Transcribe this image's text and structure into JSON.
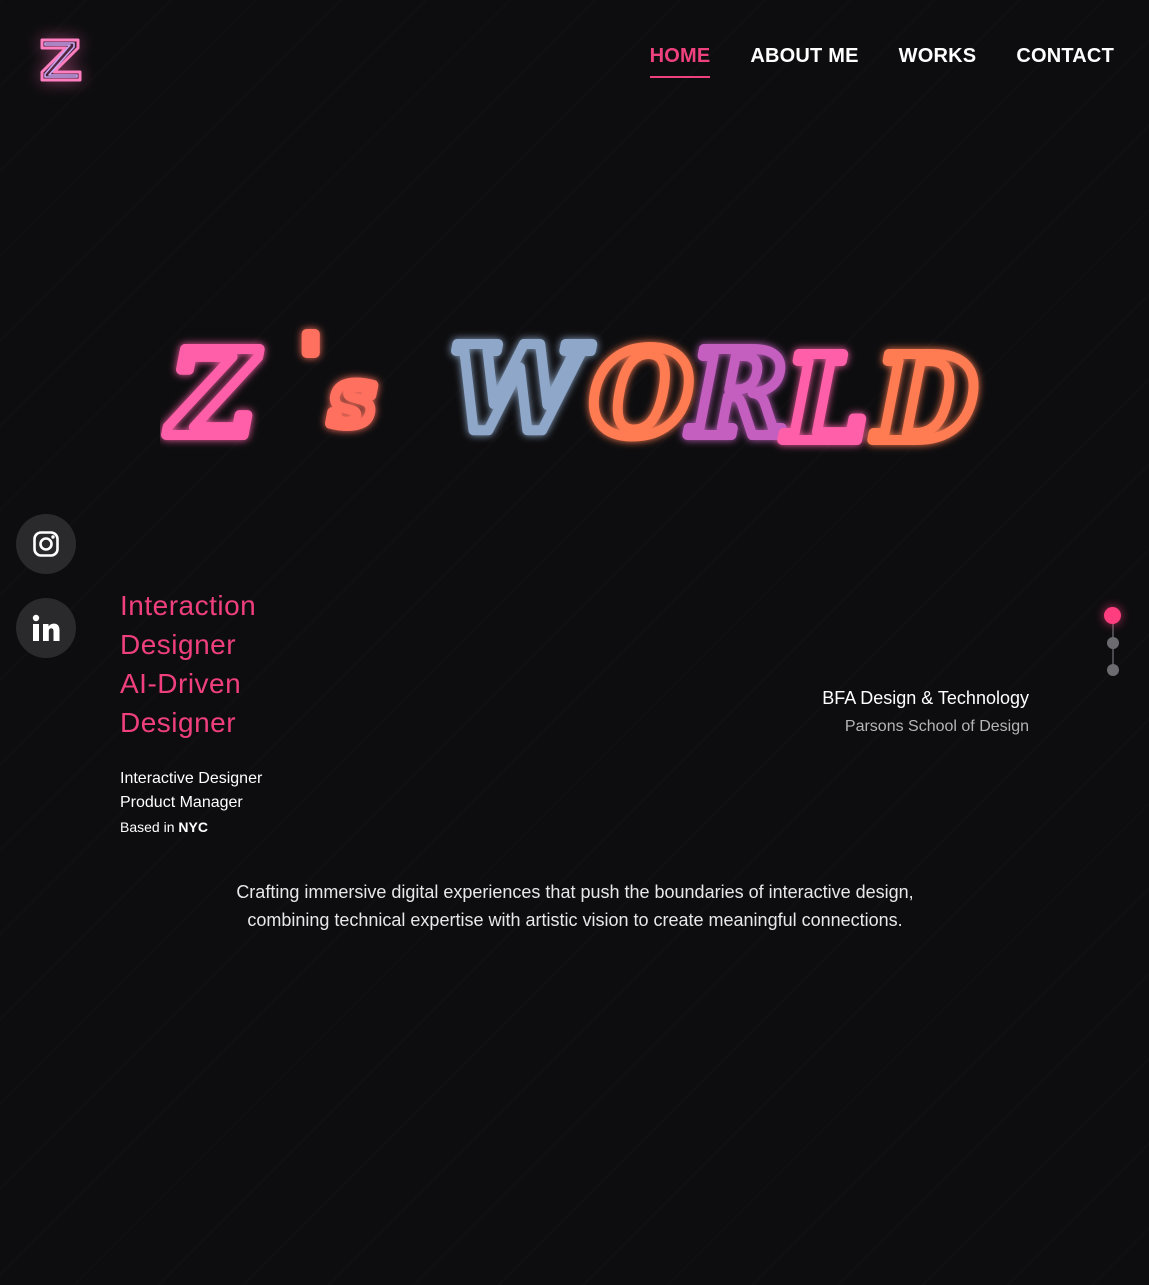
{
  "header": {
    "logo_icon": "z-logo-icon",
    "nav": [
      {
        "label": "HOME",
        "active": true
      },
      {
        "label": "ABOUT ME",
        "active": false
      },
      {
        "label": "WORKS",
        "active": false
      },
      {
        "label": "CONTACT",
        "active": false
      }
    ]
  },
  "hero": {
    "title_letters": [
      {
        "char": "Z",
        "color": "#ff5fa8"
      },
      {
        "char": "'",
        "color": "#ff6f5e"
      },
      {
        "char": "s",
        "color": "#ff6f5e"
      },
      {
        "char": "W",
        "color": "#8fa7c9"
      },
      {
        "char": "O",
        "color": "#ff7b52"
      },
      {
        "char": "R",
        "color": "#c45fc0"
      },
      {
        "char": "L",
        "color": "#ff5fa8"
      },
      {
        "char": "D",
        "color": "#ff7b52"
      }
    ]
  },
  "social": {
    "instagram_icon": "instagram-icon",
    "linkedin_icon": "linkedin-icon"
  },
  "roles": {
    "line1": "Interaction",
    "line2": "Designer",
    "line3": "AI-Driven",
    "line4": "Designer"
  },
  "info": {
    "title1": "Interactive Designer",
    "title2": "Product Manager",
    "based_prefix": "Based in",
    "based_city": "NYC"
  },
  "education": {
    "degree": "BFA Design & Technology",
    "school": "Parsons School of Design"
  },
  "description": {
    "line1": "Crafting immersive digital experiences that push the boundaries of interactive design,",
    "line2": "combining technical expertise with artistic vision to create meaningful connections."
  },
  "pagination": {
    "total": 3,
    "active_index": 0
  },
  "colors": {
    "accent": "#ef3f7e",
    "background": "#0d0d0f"
  }
}
